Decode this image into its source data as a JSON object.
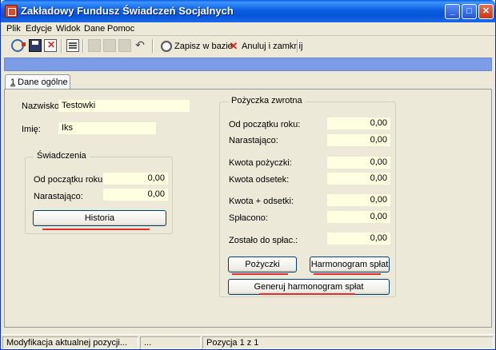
{
  "window": {
    "title": "Zakładowy Fundusz Świadczeń Socjalnych"
  },
  "menu": {
    "items": [
      "Plik",
      "Edycje",
      "Widok",
      "Dane",
      "Pomoc"
    ]
  },
  "toolbar": {
    "save_label": "Zapisz w bazie",
    "cancel_label": "Anuluj i zamknij"
  },
  "tabs": [
    {
      "label_underlined": "1",
      "label_rest": " Dane ogólne"
    }
  ],
  "form": {
    "nazwisko_label": "Nazwisko:",
    "nazwisko_value": "Testowki",
    "imie_label": "Imię:",
    "imie_value": "Iks"
  },
  "swiadczenia": {
    "title": "Świadczenia",
    "od_poczatku_label": "Od początku roku:",
    "od_poczatku_value": "0,00",
    "narastajaco_label": "Narastająco:",
    "narastajaco_value": "0,00",
    "historia_button": "Historia"
  },
  "pozyczka": {
    "title": "Pożyczka zwrotna",
    "rows": [
      {
        "label": "Od początku roku:",
        "value": "0,00"
      },
      {
        "label": "Narastająco:",
        "value": "0,00"
      },
      {
        "label": "Kwota pożyczki:",
        "value": "0,00"
      },
      {
        "label": "Kwota odsetek:",
        "value": "0,00"
      },
      {
        "label": "Kwota + odsetki:",
        "value": "0,00"
      },
      {
        "label": "Spłacono:",
        "value": "0,00"
      },
      {
        "label": "Zostało do spłac.:",
        "value": "0,00"
      }
    ],
    "pozyczki_button": "Pożyczki",
    "harmonogram_button": "Harmonogram spłat",
    "generuj_button": "Generuj harmonogram spłat"
  },
  "status": {
    "message": "Modyfikacja aktualnej pozycji...",
    "middle": "...",
    "position": "Pozycja 1 z 1"
  },
  "colors": {
    "titlebar": "#0b5fe0",
    "input_bg": "#ffffe1",
    "window_bg": "#ece9d8",
    "annotation": "#e0302a"
  }
}
